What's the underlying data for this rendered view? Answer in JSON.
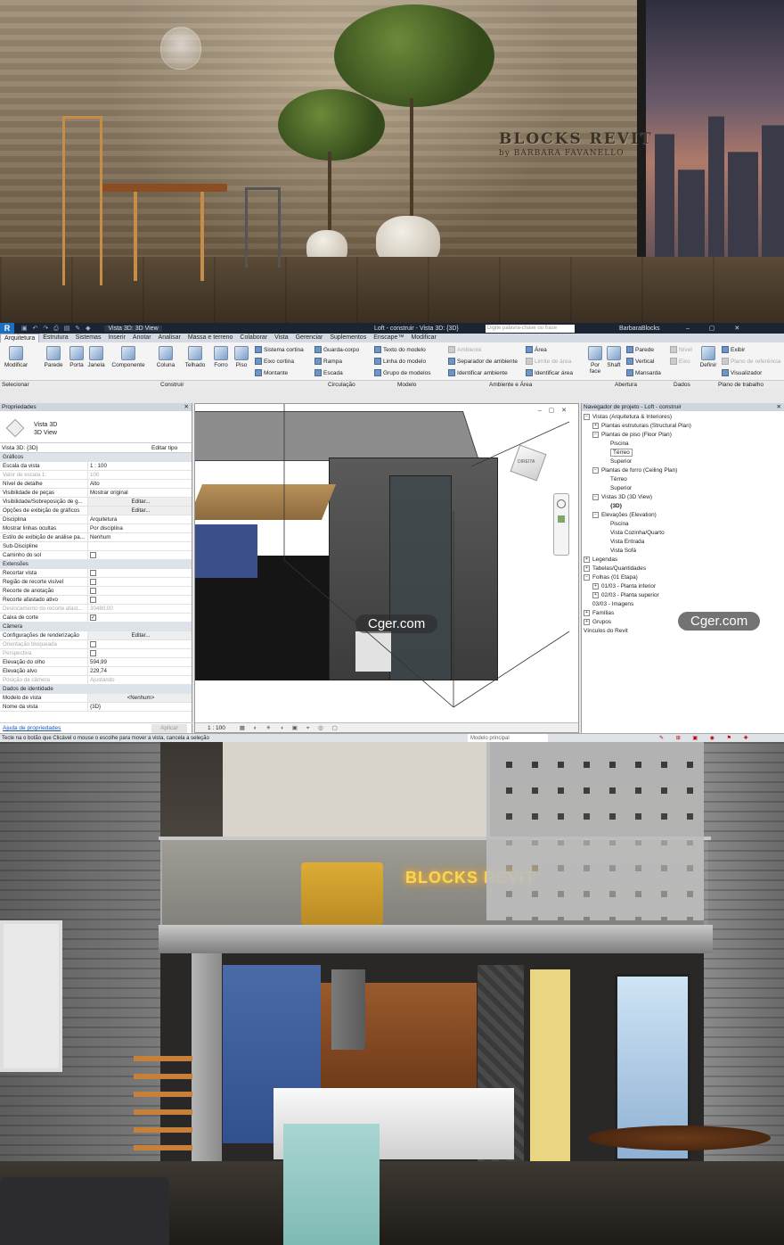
{
  "render_top": {
    "brand_title": "BLOCKS REVIT",
    "brand_sub": "by BARBARA FAVANELLO"
  },
  "titlebar": {
    "view_dropdown": "Vista 3D: 3D View",
    "title": "Loft - construir - Vista 3D: {3D}",
    "search_placeholder": "Digite palavra-chave ou frase",
    "user": "BarbaraBlocks"
  },
  "tabs": [
    "Arquitetura",
    "Estrutura",
    "Sistemas",
    "Inserir",
    "Anotar",
    "Analisar",
    "Massa e terreno",
    "Colaborar",
    "Vista",
    "Gerenciar",
    "Suplementos",
    "Enscape™",
    "Modificar"
  ],
  "ribbon": {
    "modificar": "Modificar",
    "parede": "Parede",
    "porta": "Porta",
    "janela": "Janela",
    "componente": "Componente",
    "coluna": "Coluna",
    "telhado": "Telhado",
    "forro": "Forro",
    "piso": "Piso",
    "sistema_cortina": "Sistema cortina",
    "eixo_cortina": "Eixo cortina",
    "montante": "Montante",
    "guarda_corpo": "Guarda-corpo",
    "rampa": "Rampa",
    "escada": "Escada",
    "texto_modelo": "Texto do modelo",
    "linha_modelo": "Linha do modelo",
    "grupo_modelos": "Grupo de modelos",
    "ambiente": "Ambiente",
    "separador_ambiente": "Separador de ambiente",
    "identificar_ambiente": "Identificar ambiente",
    "area": "Área",
    "limite_area": "Limite de área",
    "identificar_area": "Identificar área",
    "por_face": "Por face",
    "shaft": "Shaft",
    "parede2": "Parede",
    "vertical": "Vertical",
    "mansarda": "Mansarda",
    "nivel": "Nível",
    "eixo": "Eixo",
    "definir": "Definir",
    "exibir": "Exibir",
    "plano_ref": "Plano de referência",
    "visualizador": "Visualizador",
    "groups": {
      "selecionar": "Selecionar",
      "construir": "Construir",
      "circulacao": "Circulação",
      "modelo": "Modelo",
      "ambiente_area": "Ambiente e Área",
      "abertura": "Abertura",
      "dados": "Dados",
      "plano_trabalho": "Plano de trabalho"
    }
  },
  "properties": {
    "header": "Propriedades",
    "type_name": "Vista 3D",
    "type_sub": "3D View",
    "view_selector": "Vista 3D: {3D}",
    "edit_type": "Editar tipo",
    "rows": [
      {
        "k": "Gráficos",
        "v": "",
        "cat": true
      },
      {
        "k": "Escala da vista",
        "v": "1 : 100"
      },
      {
        "k": "Valor de escala    1:",
        "v": "100",
        "dim": true
      },
      {
        "k": "Nível de detalhe",
        "v": "Alto"
      },
      {
        "k": "Visibilidade de peças",
        "v": "Mostrar original"
      },
      {
        "k": "Visibilidade/Sobreposição de g...",
        "v": "Editar...",
        "btn": true
      },
      {
        "k": "Opções de exibição de gráficos",
        "v": "Editar...",
        "btn": true
      },
      {
        "k": "Disciplina",
        "v": "Arquitetura"
      },
      {
        "k": "Mostrar linhas ocultas",
        "v": "Por disciplina"
      },
      {
        "k": "Estilo de exibição de análise pa...",
        "v": "Nenhum"
      },
      {
        "k": "Sub-Discipline",
        "v": ""
      },
      {
        "k": "Caminho do sol",
        "v": "",
        "cb": "off"
      },
      {
        "k": "Extensões",
        "v": "",
        "cat": true
      },
      {
        "k": "Recortar vista",
        "v": "",
        "cb": "off"
      },
      {
        "k": "Região de recorte visível",
        "v": "",
        "cb": "off"
      },
      {
        "k": "Recorte de anotação",
        "v": "",
        "cb": "off"
      },
      {
        "k": "Recorte afastado ativo",
        "v": "",
        "cb": "off"
      },
      {
        "k": "Deslocamento do recorte afast...",
        "v": "30480,00",
        "dim": true
      },
      {
        "k": "Caixa de corte",
        "v": "",
        "cb": "on"
      },
      {
        "k": "Câmera",
        "v": "",
        "cat": true
      },
      {
        "k": "Configurações de renderização",
        "v": "Editar...",
        "btn": true
      },
      {
        "k": "Orientação bloqueada",
        "v": "",
        "cb": "off",
        "dim": true
      },
      {
        "k": "Perspectiva",
        "v": "",
        "cb": "off",
        "dim": true
      },
      {
        "k": "Elevação do olho",
        "v": "594,99"
      },
      {
        "k": "Elevação alvo",
        "v": "229,74"
      },
      {
        "k": "Posição da câmera",
        "v": "Ajustando",
        "dim": true
      },
      {
        "k": "Dados de identidade",
        "v": "",
        "cat": true
      },
      {
        "k": "Modelo de vista",
        "v": "<Nenhum>",
        "btn": true
      },
      {
        "k": "Nome da vista",
        "v": "{3D}"
      }
    ],
    "help_link": "Ajuda de propriedades",
    "apply": "Aplicar"
  },
  "view3d": {
    "viewcube_label": "DIREITA",
    "scale": "1 : 100",
    "watermark": "Cger.com"
  },
  "browser": {
    "header": "Navegador de projeto - Loft - construir",
    "watermark": "Cger.com",
    "nodes": [
      {
        "t": "Vistas (Arquitetura & Interiores)",
        "l": 0,
        "tg": "-"
      },
      {
        "t": "Plantas estruturais (Structural Plan)",
        "l": 1,
        "tg": "+"
      },
      {
        "t": "Plantas de piso (Floor Plan)",
        "l": 1,
        "tg": "-"
      },
      {
        "t": "Piscina",
        "l": 3
      },
      {
        "t": "Térreo",
        "l": 3,
        "box": true
      },
      {
        "t": "Superior",
        "l": 3
      },
      {
        "t": "Plantas de forro (Ceiling Plan)",
        "l": 1,
        "tg": "-"
      },
      {
        "t": "Térreo",
        "l": 3
      },
      {
        "t": "Superior",
        "l": 3
      },
      {
        "t": "Vistas 3D (3D View)",
        "l": 1,
        "tg": "-"
      },
      {
        "t": "{3D}",
        "l": 3,
        "sel": true
      },
      {
        "t": "Elevações (Elevation)",
        "l": 1,
        "tg": "-"
      },
      {
        "t": "Piscina",
        "l": 3
      },
      {
        "t": "Vista Cozinha/Quarto",
        "l": 3
      },
      {
        "t": "Vista Entrada",
        "l": 3
      },
      {
        "t": "Vista Sofá",
        "l": 3
      },
      {
        "t": "Legendas",
        "l": 0,
        "tg": "+"
      },
      {
        "t": "Tabelas/Quantidades",
        "l": 0,
        "tg": "+"
      },
      {
        "t": "Folhas (01 Etapa)",
        "l": 0,
        "tg": "-"
      },
      {
        "t": "01/03 - Planta inferior",
        "l": 1,
        "tg": "+"
      },
      {
        "t": "02/03 - Planta superior",
        "l": 1,
        "tg": "+"
      },
      {
        "t": "03/03 - Imagens",
        "l": 1
      },
      {
        "t": "Famílias",
        "l": 0,
        "tg": "+"
      },
      {
        "t": "Grupos",
        "l": 0,
        "tg": "+"
      },
      {
        "t": "Vínculos do Revit",
        "l": 0
      }
    ]
  },
  "status": {
    "text": "Tecle na o botão que Clicável o mouse o escolhe para mover a vista, cancela a seleção",
    "model": "Modelo principal"
  },
  "render_bot": {
    "neon": "BLOCKS REVIT"
  },
  "colors": {
    "accent": "#1f6fc0",
    "neon": "#ffd64a",
    "wood": "#c58d45"
  }
}
